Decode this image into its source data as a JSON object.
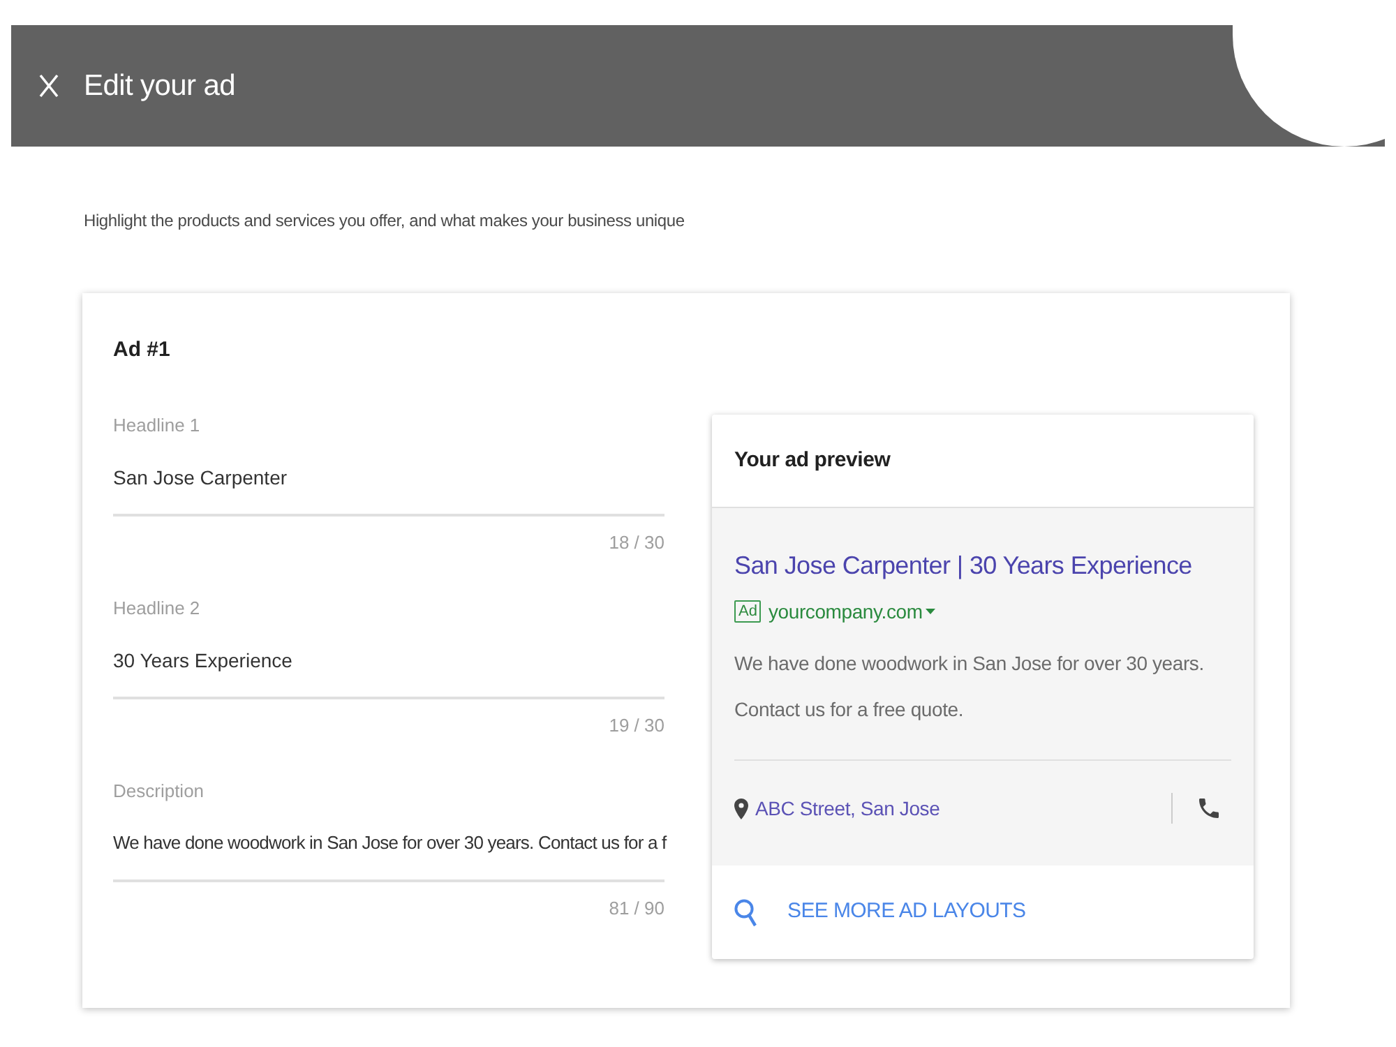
{
  "header": {
    "title": "Edit your ad"
  },
  "intro": "Highlight the products and services you offer, and what makes your business unique",
  "ad_form": {
    "title": "Ad #1",
    "fields": [
      {
        "label": "Headline 1",
        "value": "San Jose Carpenter",
        "counter": "18 / 30"
      },
      {
        "label": "Headline 2",
        "value": "30 Years Experience",
        "counter": "19 / 30"
      },
      {
        "label": "Description",
        "value": "We have done woodwork in San Jose for over 30 years. Contact us for a f",
        "counter": "81 / 90"
      }
    ]
  },
  "preview": {
    "title": "Your ad preview",
    "headline": "San Jose Carpenter | 30 Years Experience",
    "badge": "Ad",
    "url": "yourcompany.com",
    "description_lines": [
      "We have done woodwork in San Jose for over 30 years.",
      "Contact us for a free quote."
    ],
    "location": "ABC Street, San Jose",
    "more_layouts": "SEE MORE AD LAYOUTS"
  }
}
